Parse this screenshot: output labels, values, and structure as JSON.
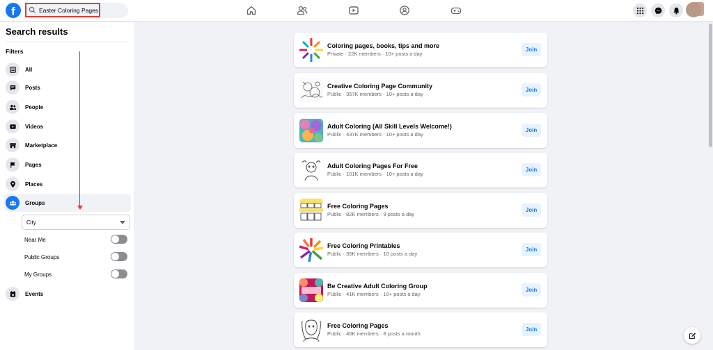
{
  "header": {
    "logo": "f",
    "search_value": "Easter Coloring Pages",
    "nav_icons": [
      "home-icon",
      "friends-icon",
      "watch-icon",
      "groups-icon",
      "gaming-icon"
    ],
    "right_icons": [
      "menu-grid-icon",
      "messenger-icon",
      "notifications-icon"
    ]
  },
  "sidebar": {
    "title": "Search results",
    "filters_label": "Filters",
    "items": [
      {
        "label": "All",
        "icon": "all-icon"
      },
      {
        "label": "Posts",
        "icon": "posts-icon"
      },
      {
        "label": "People",
        "icon": "people-icon"
      },
      {
        "label": "Videos",
        "icon": "videos-icon"
      },
      {
        "label": "Marketplace",
        "icon": "marketplace-icon"
      },
      {
        "label": "Pages",
        "icon": "pages-flag-icon"
      },
      {
        "label": "Places",
        "icon": "places-pin-icon"
      },
      {
        "label": "Groups",
        "icon": "groups-icon"
      },
      {
        "label": "Events",
        "icon": "events-icon"
      }
    ],
    "city_select": "City",
    "toggles": [
      {
        "label": "Near Me",
        "on": false
      },
      {
        "label": "Public Groups",
        "on": false
      },
      {
        "label": "My Groups",
        "on": false
      }
    ]
  },
  "results": [
    {
      "title": "Coloring pages, books, tips and more",
      "meta": "Private · 22K members · 10+ posts a day",
      "join": "Join"
    },
    {
      "title": "Creative Coloring Page Community",
      "meta": "Public · 357K members · 10+ posts a day",
      "join": "Join"
    },
    {
      "title": "Adult Coloring (All Skill Levels Welcome!)",
      "meta": "Public · 437K members · 10+ posts a day",
      "join": "Join"
    },
    {
      "title": "Adult Coloring Pages For Free",
      "meta": "Public · 101K members · 10+ posts a day",
      "join": "Join"
    },
    {
      "title": "Free Coloring Pages",
      "meta": "Public · 82K members · 9 posts a day",
      "join": "Join"
    },
    {
      "title": "Free Coloring Printables",
      "meta": "Public · 35K members · 10 posts a day",
      "join": "Join"
    },
    {
      "title": "Be Creative Adult Coloring Group",
      "meta": "Public · 41K members · 10+ posts a day",
      "join": "Join"
    },
    {
      "title": "Free Coloring Pages",
      "meta": "Public · 40K members · 8 posts a month",
      "join": "Join"
    }
  ],
  "colors": {
    "brand": "#1877f2",
    "annotation": "#e53935"
  }
}
